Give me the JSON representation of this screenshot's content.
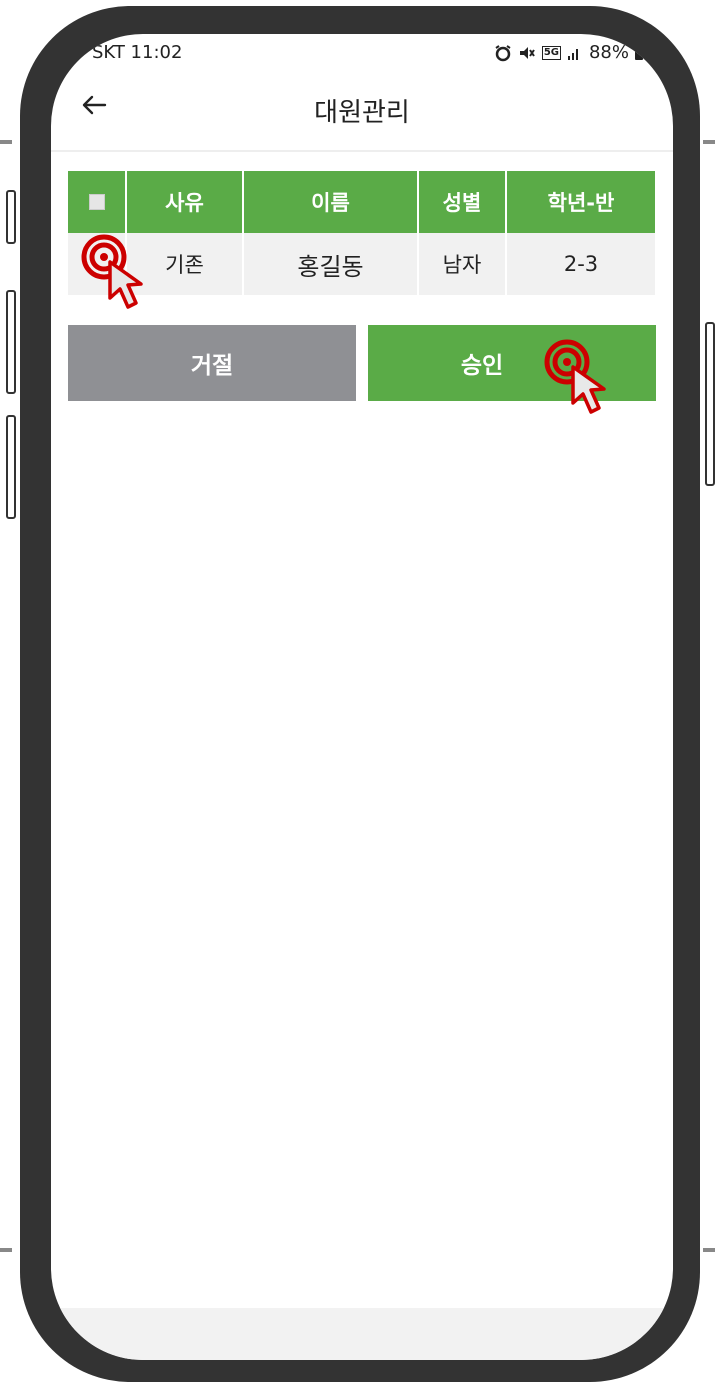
{
  "status_bar": {
    "carrier_time": "SKT 11:02",
    "network_badge": "5G",
    "battery_percent": "88%",
    "icons": [
      "alarm-icon",
      "mute-icon",
      "5g-icon",
      "signal-icon",
      "battery-icon"
    ]
  },
  "app_bar": {
    "title": "대원관리",
    "back_icon": "arrow-left-icon"
  },
  "table": {
    "headers": [
      "사유",
      "이름",
      "성별",
      "학년-반"
    ],
    "rows": [
      {
        "reason": "기존",
        "name": "홍길동",
        "gender": "남자",
        "grade_class": "2-3"
      }
    ]
  },
  "actions": {
    "reject_label": "거절",
    "approve_label": "승인"
  },
  "colors": {
    "accent": "#5aab47",
    "reject": "#8f9094",
    "frame": "#333333",
    "tap_marker": "#cc0000"
  }
}
